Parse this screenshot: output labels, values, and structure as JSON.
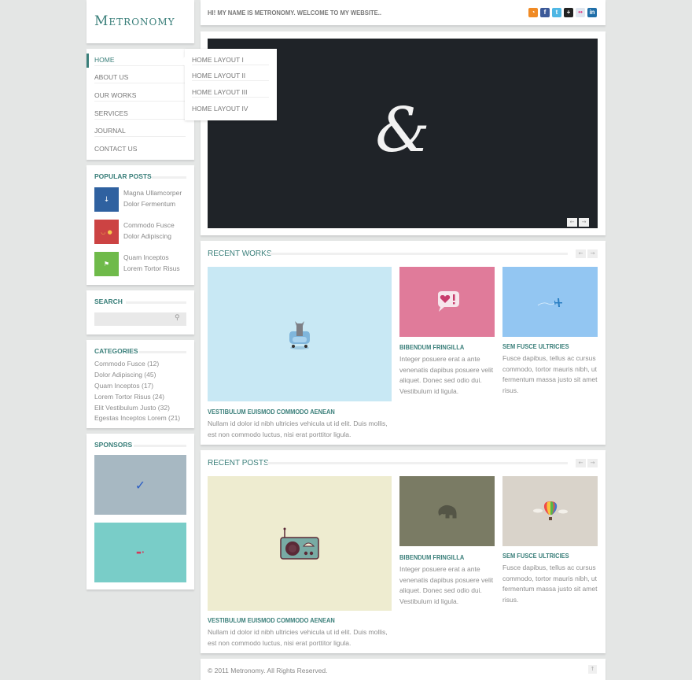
{
  "site": {
    "logo": "Metronomy"
  },
  "topbar": {
    "welcome": "HI! MY NAME IS METRONOMY. WELCOME TO MY WEBSITE..",
    "social": [
      {
        "name": "rss-icon",
        "glyph": "◔",
        "color": "#f08a24"
      },
      {
        "name": "facebook-icon",
        "glyph": "f",
        "color": "#3b5998"
      },
      {
        "name": "twitter-icon",
        "glyph": "t",
        "color": "#4fb7e4"
      },
      {
        "name": "google-plus-icon",
        "glyph": "+",
        "color": "#222222"
      },
      {
        "name": "flickr-icon",
        "glyph": "••",
        "color": "#cfd8e6"
      },
      {
        "name": "linkedin-icon",
        "glyph": "in",
        "color": "#1f6ea8"
      }
    ]
  },
  "nav": {
    "items": [
      "Home",
      "About Us",
      "Our Works",
      "Services",
      "Journal",
      "Contact Us"
    ],
    "active_index": 0,
    "dropdown": [
      "Home Layout I",
      "Home Layout II",
      "Home Layout III",
      "Home Layout IV"
    ]
  },
  "popular": {
    "title": "Popular Posts",
    "posts": [
      {
        "line1": "Magna Ullamcorper",
        "line2": "Dolor Fermentum",
        "color": "#2f61a0",
        "icon": "↓"
      },
      {
        "line1": "Commodo Fusce",
        "line2": "Dolor Adipiscing",
        "color": "#cc4343",
        "icon": "◡ ●"
      },
      {
        "line1": "Quam Inceptos",
        "line2": "Lorem Tortor Risus",
        "color": "#6fba4a",
        "icon": "⚑"
      }
    ]
  },
  "search": {
    "title": "Search",
    "placeholder": "",
    "value": ""
  },
  "categories": {
    "title": "Categories",
    "items": [
      "Commodo Fusce (12)",
      "Dolor Adipiscing (45)",
      "Quam Inceptos (17)",
      "Lorem Tortor Risus (24)",
      "Elit Vestibulum Justo (32)",
      "Egestas Inceptos Lorem (21)"
    ]
  },
  "sponsors": {
    "title": "Sponsors",
    "items": [
      {
        "name": "sponsor-pipe",
        "color": "#a7b8c2",
        "icon": "✓",
        "icon_color": "#2c5ec4"
      },
      {
        "name": "sponsor-bus",
        "color": "#79cdc8",
        "icon": "▬•",
        "icon_color": "#d23a5a"
      }
    ]
  },
  "slider": {
    "glyph": "&",
    "prev": "←",
    "next": "→"
  },
  "recent_works": {
    "title": "Recent Works",
    "prev": "←",
    "next": "→",
    "items": [
      {
        "title": "Vestibulum Euismod Commodo Aenean",
        "text": "Nullam id dolor id nibh ultricies vehicula ut id elit. Duis mollis, est non commodo luctus, nisi erat porttitor ligula.",
        "color": "#c8e8f4",
        "icon": "cat-on-chair"
      },
      {
        "title": "Bibendum Fringilla",
        "text": "Integer posuere erat a ante venenatis dapibus posuere velit aliquet. Donec sed odio dui. Vestibulum id ligula.",
        "color": "#e07b9a",
        "icon": "heart-bubble"
      },
      {
        "title": "Sem Fusce Ultricies",
        "text": "Fusce dapibus, tellus ac cursus commodo, tortor mauris nibh, ut fermentum massa justo sit amet risus.",
        "color": "#93c6f2",
        "icon": "airplane"
      }
    ]
  },
  "recent_posts": {
    "title": "Recent Posts",
    "prev": "←",
    "next": "→",
    "items": [
      {
        "title": "Vestibulum Euismod Commodo Aenean",
        "text": "Nullam id dolor id nibh ultricies vehicula ut id elit. Duis mollis, est non commodo luctus, nisi erat porttitor ligula.",
        "color": "#eeecd0",
        "icon": "radio"
      },
      {
        "title": "Bibendum Fringilla",
        "text": "Integer posuere erat a ante venenatis dapibus posuere velit aliquet. Donec sed odio dui. Vestibulum id ligula.",
        "color": "#7a7b64",
        "icon": "elephant"
      },
      {
        "title": "Sem Fusce Ultricies",
        "text": "Fusce dapibus, tellus ac cursus commodo, tortor mauris nibh, ut fermentum massa justo sit amet risus.",
        "color": "#d9d3ca",
        "icon": "hot-air-balloon"
      }
    ]
  },
  "footer": {
    "copyright": "© 2011 Metronomy. All Rights Reserved.",
    "top": "↑"
  }
}
